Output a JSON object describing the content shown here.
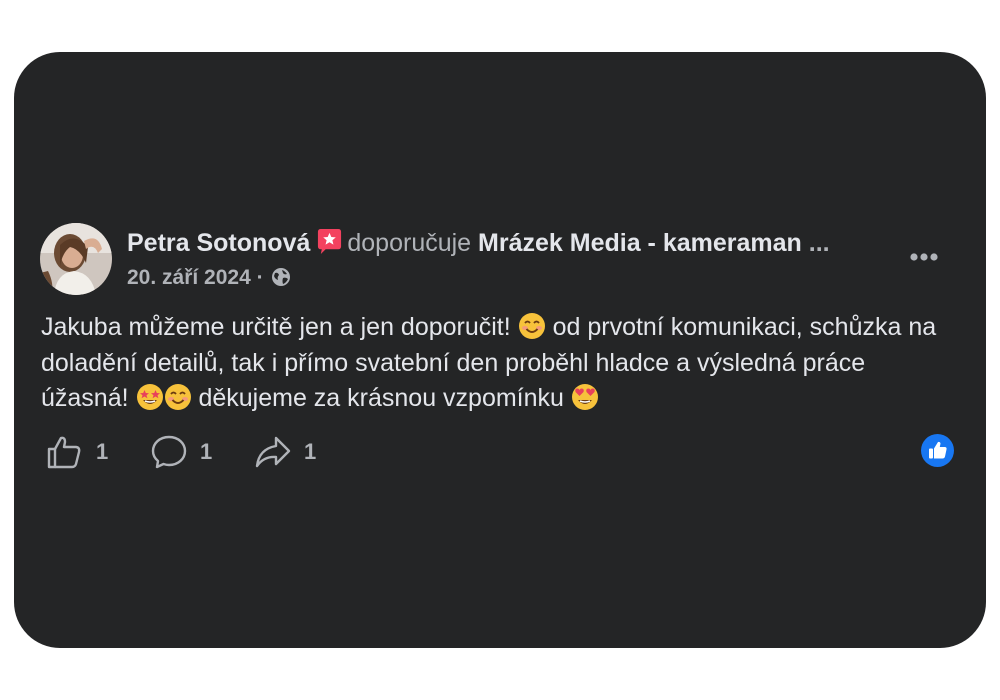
{
  "post": {
    "author": "Petra Sotonová",
    "verb": "doporučuje",
    "page_name": "Mrázek Media - kameraman",
    "truncation": "...",
    "date": "20. září 2024",
    "separator": "·",
    "text_segments": [
      "Jakuba můžeme určitě jen a jen doporučit! ",
      " od prvotní komunikaci, schůzka na doladění detailů, tak i přímo svatební den proběhl hladce a výsledná práce úžasná! ",
      " děkujeme za krásnou vzpomínku "
    ],
    "icons": {
      "recommend": "recommend-badge-icon",
      "audience": "globe-icon",
      "more": "more-options-icon",
      "like": "like-icon",
      "comment": "comment-icon",
      "share": "share-icon",
      "reaction": "like-reaction-icon"
    }
  },
  "actions": {
    "like_count": "1",
    "comment_count": "1",
    "share_count": "1"
  },
  "colors": {
    "card_background": "#242526",
    "primary_text": "#e4e6eb",
    "secondary_text": "#b0b3b8",
    "recommend_badge": "#f3425f",
    "like_blue": "#1877f2"
  }
}
